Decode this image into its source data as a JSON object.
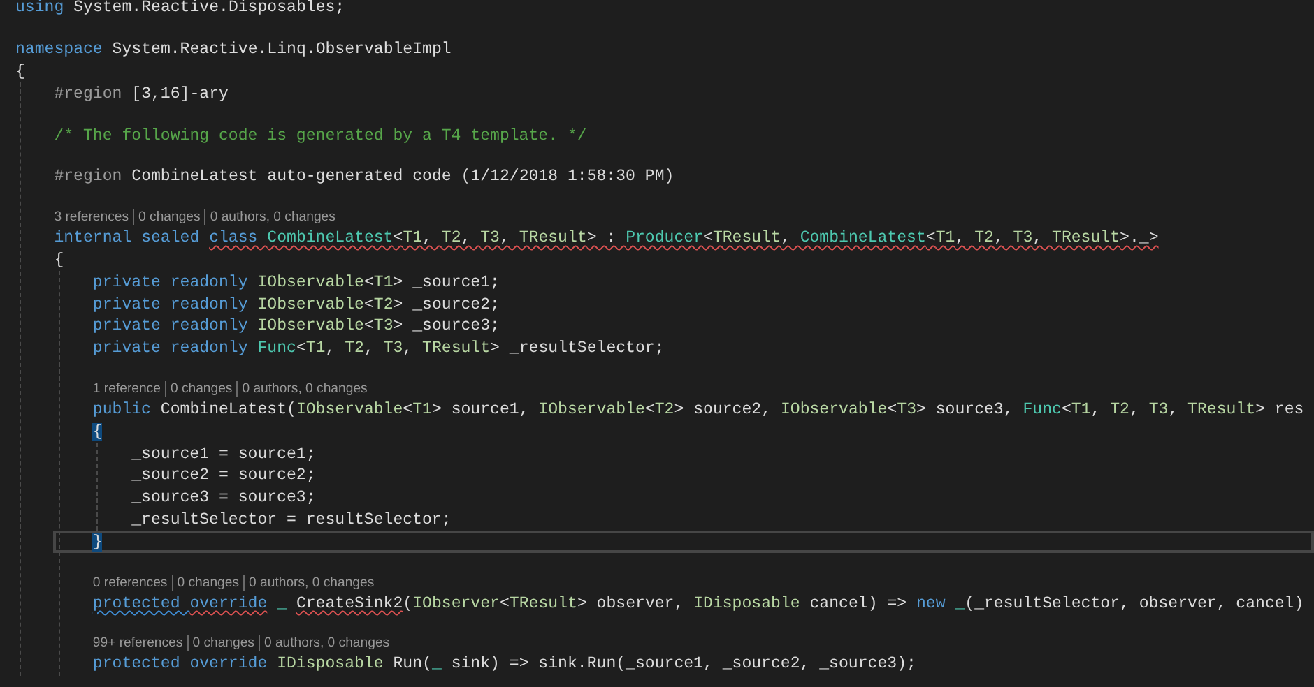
{
  "editor": {
    "lines": [
      {
        "kind": "code",
        "current": false,
        "tokens": [
          {
            "text": "using",
            "kind": "keyword"
          },
          {
            "text": " System.Reactive.Disposables;",
            "kind": "plain"
          }
        ]
      },
      {
        "kind": "blank"
      },
      {
        "kind": "code",
        "current": false,
        "tokens": [
          {
            "text": "namespace",
            "kind": "keyword"
          },
          {
            "text": " System.Reactive.Linq.ObservableImpl",
            "kind": "plain"
          }
        ]
      },
      {
        "kind": "code",
        "current": false,
        "tokens": [
          {
            "text": "{",
            "kind": "plain"
          }
        ]
      },
      {
        "kind": "block",
        "children": [
          {
            "kind": "code",
            "current": false,
            "tokens": [
              {
                "text": "#region",
                "kind": "preproc"
              },
              {
                "text": " [3,16]-ary",
                "kind": "plain"
              }
            ]
          },
          {
            "kind": "blank"
          },
          {
            "kind": "code",
            "current": false,
            "tokens": [
              {
                "text": "/* The following code is generated by a T4 template. */",
                "kind": "comment"
              }
            ]
          },
          {
            "kind": "blank"
          },
          {
            "kind": "code",
            "current": false,
            "tokens": [
              {
                "text": "#region",
                "kind": "preproc"
              },
              {
                "text": " CombineLatest auto-generated code (1/12/2018 1:58:30 PM)",
                "kind": "plain"
              }
            ]
          },
          {
            "kind": "blank"
          },
          {
            "kind": "lens",
            "items": [
              "3 references",
              "0 changes",
              "0 authors, 0 changes"
            ]
          },
          {
            "kind": "code",
            "current": false,
            "tokens": [
              {
                "text": "internal sealed ",
                "kind": "keyword"
              },
              {
                "kind": "error_squiggle",
                "tokens": [
                  {
                    "text": "class ",
                    "kind": "keyword"
                  },
                  {
                    "text": "CombineLatest",
                    "kind": "type"
                  },
                  {
                    "text": "<",
                    "kind": "plain"
                  },
                  {
                    "text": "T1",
                    "kind": "param"
                  },
                  {
                    "text": ", ",
                    "kind": "plain"
                  },
                  {
                    "text": "T2",
                    "kind": "param"
                  },
                  {
                    "text": ", ",
                    "kind": "plain"
                  },
                  {
                    "text": "T3",
                    "kind": "param"
                  },
                  {
                    "text": ", ",
                    "kind": "plain"
                  },
                  {
                    "text": "TResult",
                    "kind": "param"
                  },
                  {
                    "text": "> : ",
                    "kind": "plain"
                  },
                  {
                    "text": "Producer",
                    "kind": "type"
                  },
                  {
                    "text": "<",
                    "kind": "plain"
                  },
                  {
                    "text": "TResult",
                    "kind": "param"
                  },
                  {
                    "text": ", ",
                    "kind": "plain"
                  },
                  {
                    "text": "CombineLatest",
                    "kind": "type"
                  },
                  {
                    "text": "<",
                    "kind": "plain"
                  },
                  {
                    "text": "T1",
                    "kind": "param"
                  },
                  {
                    "text": ", ",
                    "kind": "plain"
                  },
                  {
                    "text": "T2",
                    "kind": "param"
                  },
                  {
                    "text": ", ",
                    "kind": "plain"
                  },
                  {
                    "text": "T3",
                    "kind": "param"
                  },
                  {
                    "text": ", ",
                    "kind": "plain"
                  },
                  {
                    "text": "TResult",
                    "kind": "param"
                  },
                  {
                    "text": ">._>",
                    "kind": "plain"
                  }
                ]
              }
            ]
          },
          {
            "kind": "code",
            "current": false,
            "tokens": [
              {
                "text": "{",
                "kind": "plain"
              }
            ]
          },
          {
            "kind": "block",
            "children": [
              {
                "kind": "code",
                "current": false,
                "tokens": [
                  {
                    "text": "private readonly ",
                    "kind": "keyword"
                  },
                  {
                    "text": "IObservable",
                    "kind": "param"
                  },
                  {
                    "text": "<",
                    "kind": "plain"
                  },
                  {
                    "text": "T1",
                    "kind": "param"
                  },
                  {
                    "text": "> _source1;",
                    "kind": "plain"
                  }
                ]
              },
              {
                "kind": "code",
                "current": false,
                "tokens": [
                  {
                    "text": "private readonly ",
                    "kind": "keyword"
                  },
                  {
                    "text": "IObservable",
                    "kind": "param"
                  },
                  {
                    "text": "<",
                    "kind": "plain"
                  },
                  {
                    "text": "T2",
                    "kind": "param"
                  },
                  {
                    "text": "> _source2;",
                    "kind": "plain"
                  }
                ]
              },
              {
                "kind": "code",
                "current": false,
                "tokens": [
                  {
                    "text": "private readonly ",
                    "kind": "keyword"
                  },
                  {
                    "text": "IObservable",
                    "kind": "param"
                  },
                  {
                    "text": "<",
                    "kind": "plain"
                  },
                  {
                    "text": "T3",
                    "kind": "param"
                  },
                  {
                    "text": "> _source3;",
                    "kind": "plain"
                  }
                ]
              },
              {
                "kind": "code",
                "current": false,
                "tokens": [
                  {
                    "text": "private readonly ",
                    "kind": "keyword"
                  },
                  {
                    "text": "Func",
                    "kind": "type"
                  },
                  {
                    "text": "<",
                    "kind": "plain"
                  },
                  {
                    "text": "T1",
                    "kind": "param"
                  },
                  {
                    "text": ", ",
                    "kind": "plain"
                  },
                  {
                    "text": "T2",
                    "kind": "param"
                  },
                  {
                    "text": ", ",
                    "kind": "plain"
                  },
                  {
                    "text": "T3",
                    "kind": "param"
                  },
                  {
                    "text": ", ",
                    "kind": "plain"
                  },
                  {
                    "text": "TResult",
                    "kind": "param"
                  },
                  {
                    "text": "> _resultSelector;",
                    "kind": "plain"
                  }
                ]
              },
              {
                "kind": "blank"
              },
              {
                "kind": "lens",
                "items": [
                  "1 reference",
                  "0 changes",
                  "0 authors, 0 changes"
                ]
              },
              {
                "kind": "code",
                "current": false,
                "tokens": [
                  {
                    "text": "public ",
                    "kind": "keyword"
                  },
                  {
                    "text": "CombineLatest(",
                    "kind": "plain"
                  },
                  {
                    "text": "IObservable",
                    "kind": "param"
                  },
                  {
                    "text": "<",
                    "kind": "plain"
                  },
                  {
                    "text": "T1",
                    "kind": "param"
                  },
                  {
                    "text": "> source1, ",
                    "kind": "plain"
                  },
                  {
                    "text": "IObservable",
                    "kind": "param"
                  },
                  {
                    "text": "<",
                    "kind": "plain"
                  },
                  {
                    "text": "T2",
                    "kind": "param"
                  },
                  {
                    "text": "> source2, ",
                    "kind": "plain"
                  },
                  {
                    "text": "IObservable",
                    "kind": "param"
                  },
                  {
                    "text": "<",
                    "kind": "plain"
                  },
                  {
                    "text": "T3",
                    "kind": "param"
                  },
                  {
                    "text": "> source3, ",
                    "kind": "plain"
                  },
                  {
                    "text": "Func",
                    "kind": "type"
                  },
                  {
                    "text": "<",
                    "kind": "plain"
                  },
                  {
                    "text": "T1",
                    "kind": "param"
                  },
                  {
                    "text": ", ",
                    "kind": "plain"
                  },
                  {
                    "text": "T2",
                    "kind": "param"
                  },
                  {
                    "text": ", ",
                    "kind": "plain"
                  },
                  {
                    "text": "T3",
                    "kind": "param"
                  },
                  {
                    "text": ", ",
                    "kind": "plain"
                  },
                  {
                    "text": "TResult",
                    "kind": "param"
                  },
                  {
                    "text": "> res",
                    "kind": "plain"
                  }
                ]
              },
              {
                "kind": "code",
                "current": false,
                "tokens": [
                  {
                    "text": "{",
                    "kind": "plain",
                    "matched": true
                  }
                ]
              },
              {
                "kind": "block",
                "children": [
                  {
                    "kind": "code",
                    "current": false,
                    "tokens": [
                      {
                        "text": "_source1 = source1;",
                        "kind": "plain"
                      }
                    ]
                  },
                  {
                    "kind": "code",
                    "current": false,
                    "tokens": [
                      {
                        "text": "_source2 = source2;",
                        "kind": "plain"
                      }
                    ]
                  },
                  {
                    "kind": "code",
                    "current": false,
                    "tokens": [
                      {
                        "text": "_source3 = source3;",
                        "kind": "plain"
                      }
                    ]
                  },
                  {
                    "kind": "code",
                    "current": false,
                    "tokens": [
                      {
                        "text": "_resultSelector = resultSelector;",
                        "kind": "plain"
                      }
                    ]
                  }
                ]
              },
              {
                "kind": "code",
                "current": true,
                "tokens": [
                  {
                    "text": "}",
                    "kind": "plain",
                    "matched": true
                  }
                ]
              },
              {
                "kind": "blank"
              },
              {
                "kind": "lens",
                "items": [
                  "0 references",
                  "0 changes",
                  "0 authors, 0 changes"
                ]
              },
              {
                "kind": "code",
                "current": false,
                "tokens": [
                  {
                    "kind": "info_squiggle",
                    "tokens": [
                      {
                        "text": "protected ",
                        "kind": "keyword"
                      }
                    ]
                  },
                  {
                    "kind": "error_squiggle",
                    "tokens": [
                      {
                        "text": "override",
                        "kind": "keyword"
                      }
                    ]
                  },
                  {
                    "text": " _ ",
                    "kind": "type"
                  },
                  {
                    "kind": "error_squiggle",
                    "tokens": [
                      {
                        "text": "CreateSink2",
                        "kind": "plain"
                      }
                    ]
                  },
                  {
                    "text": "(",
                    "kind": "plain"
                  },
                  {
                    "text": "IObserver",
                    "kind": "param"
                  },
                  {
                    "text": "<",
                    "kind": "plain"
                  },
                  {
                    "text": "TResult",
                    "kind": "param"
                  },
                  {
                    "text": "> observer, ",
                    "kind": "plain"
                  },
                  {
                    "text": "IDisposable",
                    "kind": "param"
                  },
                  {
                    "text": " cancel) => ",
                    "kind": "plain"
                  },
                  {
                    "text": "new",
                    "kind": "keyword"
                  },
                  {
                    "text": " _",
                    "kind": "type"
                  },
                  {
                    "text": "(_resultSelector, observer, cancel)",
                    "kind": "plain"
                  }
                ]
              },
              {
                "kind": "blank"
              },
              {
                "kind": "lens",
                "items": [
                  "99+ references",
                  "0 changes",
                  "0 authors, 0 changes"
                ]
              },
              {
                "kind": "code",
                "current": false,
                "tokens": [
                  {
                    "text": "protected override ",
                    "kind": "keyword"
                  },
                  {
                    "text": "IDisposable",
                    "kind": "param"
                  },
                  {
                    "text": " Run(",
                    "kind": "plain"
                  },
                  {
                    "text": "_",
                    "kind": "type"
                  },
                  {
                    "text": " sink) => sink.Run(_source1, _source2, _source3);",
                    "kind": "plain"
                  }
                ]
              }
            ]
          }
        ]
      }
    ]
  }
}
